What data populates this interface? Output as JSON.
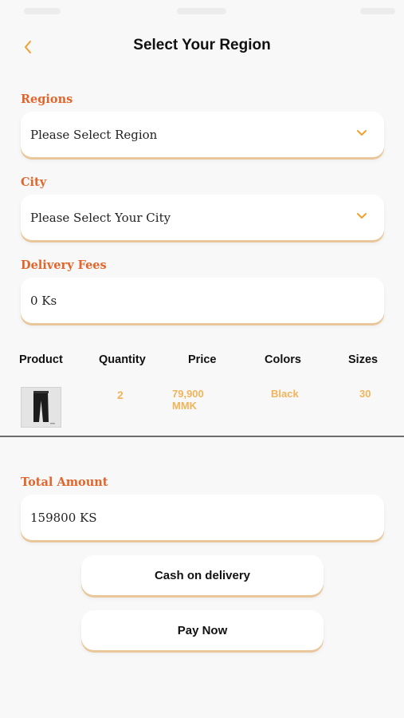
{
  "header": {
    "title": "Select Your Region",
    "back_icon": "chevron-left-icon"
  },
  "colors": {
    "accent_label": "#e2662c",
    "accent_value": "#f0b45a",
    "field_shadow": "#e9c79a",
    "background": "#f8f8f8"
  },
  "regions": {
    "label": "Regions",
    "value": "Please Select Region",
    "icon": "chevron-down-icon"
  },
  "city": {
    "label": "City",
    "value": "Please Select Your City",
    "icon": "chevron-down-icon"
  },
  "delivery": {
    "label": "Delivery Fees",
    "value": "0 Ks"
  },
  "table": {
    "headers": [
      "Product",
      "Quantity",
      "Price",
      "Colors",
      "Sizes"
    ],
    "rows": [
      {
        "image": "black-pants-thumbnail",
        "quantity": "2",
        "price_amount": "79,900",
        "price_currency": "MMK",
        "color": "Black",
        "size": "30"
      }
    ]
  },
  "total": {
    "label": "Total Amount",
    "value": "159800 KS"
  },
  "actions": {
    "cash_label": "Cash on delivery",
    "pay_label": "Pay Now"
  }
}
